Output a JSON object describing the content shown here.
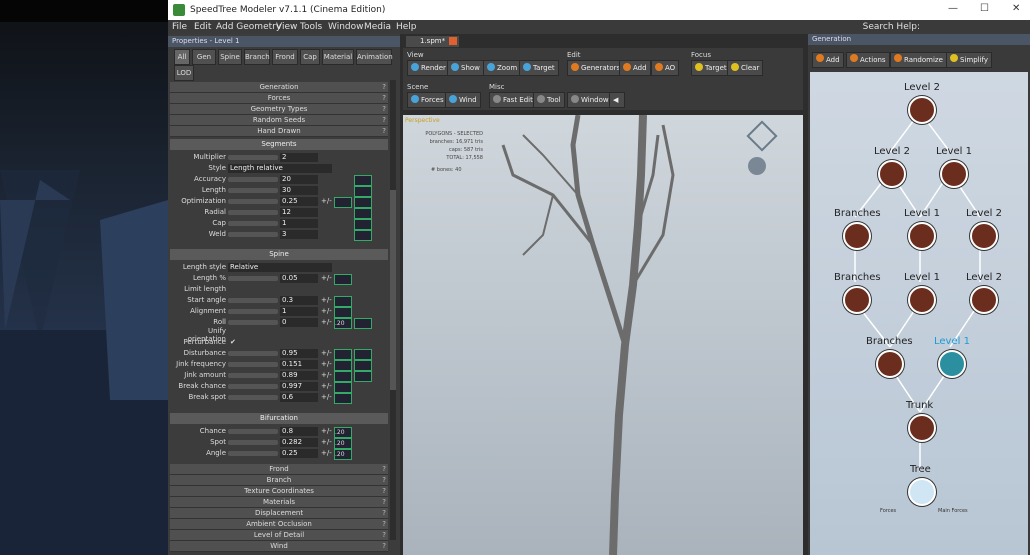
{
  "window": {
    "title": "SpeedTree Modeler v7.1.1 (Cinema Edition)"
  },
  "menu": [
    "File",
    "Edit",
    "Add Geometry",
    "View",
    "Tools",
    "Window",
    "Media",
    "Help"
  ],
  "search_help": "Search Help:",
  "properties": {
    "header": "Properties - Level 1",
    "tabs": [
      "All",
      "Gen",
      "Spine",
      "Branch",
      "Frond",
      "Cap",
      "Material",
      "Animation",
      "LOD"
    ],
    "sections_top": [
      "Generation",
      "Forces",
      "Geometry Types",
      "Random Seeds",
      "Hand Drawn"
    ],
    "segments_title": "Segments",
    "segments": [
      {
        "label": "Multiplier",
        "value": "2"
      },
      {
        "label": "Style",
        "value": "Length relative"
      },
      {
        "label": "Accuracy",
        "value": "20"
      },
      {
        "label": "Length",
        "value": "30"
      },
      {
        "label": "Optimization",
        "value": "0.25"
      },
      {
        "label": "Radial",
        "value": "12"
      },
      {
        "label": "Cap",
        "value": "1"
      },
      {
        "label": "Weld",
        "value": "3"
      }
    ],
    "spine_title": "Spine",
    "spine": [
      {
        "label": "Length style",
        "value": "Relative"
      },
      {
        "label": "Length %",
        "value": "0.05"
      },
      {
        "label": "Limit length",
        "value": ""
      },
      {
        "label": "Start angle",
        "value": "0.3"
      },
      {
        "label": "Alignment",
        "value": "1"
      },
      {
        "label": "Roll",
        "value": "0"
      },
      {
        "label": "Unify orientation",
        "value": ""
      },
      {
        "label": "Perturbance",
        "value": "✔"
      },
      {
        "label": "Disturbance",
        "value": "0.95"
      },
      {
        "label": "Jink frequency",
        "value": "0.151"
      },
      {
        "label": "Jink amount",
        "value": "0.89"
      },
      {
        "label": "Break chance",
        "value": "0.997"
      },
      {
        "label": "Break spot",
        "value": "0.6"
      }
    ],
    "roll_extra": ".20",
    "bifurcation_title": "Bifurcation",
    "bifurcation": [
      {
        "label": "Chance",
        "value": "0.8",
        "extra": ".20"
      },
      {
        "label": "Spot",
        "value": "0.282",
        "extra": ".20"
      },
      {
        "label": "Angle",
        "value": "0.25",
        "extra": ".20"
      }
    ],
    "sections_bottom": [
      "Frond",
      "Branch",
      "Texture Coordinates",
      "Materials",
      "Displacement",
      "Ambient Occlusion",
      "Level of Detail",
      "Wind"
    ]
  },
  "doc_tab": "1.spm*",
  "toolbar": {
    "view_label": "View",
    "view_buttons": [
      "Render",
      "Show",
      "Zoom",
      "Target"
    ],
    "edit_label": "Edit",
    "edit_buttons": [
      "Generators",
      "Add",
      "AO"
    ],
    "focus_label": "Focus",
    "focus_buttons": [
      "Target",
      "Clear"
    ],
    "scene_label": "Scene",
    "scene_buttons": [
      "Forces",
      "Wind"
    ],
    "misc_label": "Misc",
    "misc_buttons": [
      "Fast Edit",
      "Tool",
      "Window"
    ]
  },
  "viewport": {
    "label": "Perspective",
    "stats": [
      "POLYGONS - SELECTED",
      "branches: 16,971 tris",
      "caps: 587 tris",
      "TOTAL: 17,558",
      "# bones: 40"
    ]
  },
  "generation": {
    "header": "Generation",
    "buttons": [
      "Add",
      "Actions",
      "Randomize",
      "Simplify"
    ],
    "nodes": [
      {
        "label": "Level 2"
      },
      {
        "label": "Level 2"
      },
      {
        "label": "Level 1"
      },
      {
        "label": "Branches"
      },
      {
        "label": "Level 1"
      },
      {
        "label": "Level 2"
      },
      {
        "label": "Branches"
      },
      {
        "label": "Level 1"
      },
      {
        "label": "Level 2"
      },
      {
        "label": "Branches"
      },
      {
        "label": "Level 1"
      },
      {
        "label": "Trunk"
      },
      {
        "label": "Tree"
      }
    ],
    "footer": [
      "Forces",
      "Main Forces"
    ]
  }
}
